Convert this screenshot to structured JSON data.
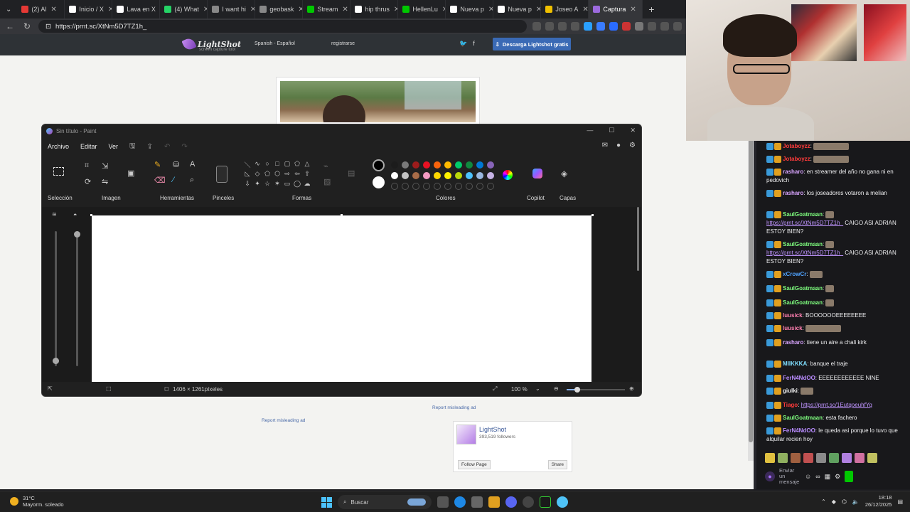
{
  "browser": {
    "tabs": [
      {
        "label": "(2) Al",
        "color": "#e53935"
      },
      {
        "label": "Inicio / X",
        "color": "#ffffff"
      },
      {
        "label": "Lava en X",
        "color": "#ffffff"
      },
      {
        "label": "(4) What",
        "color": "#25d366"
      },
      {
        "label": "I want hi",
        "color": "#888888"
      },
      {
        "label": "geobask",
        "color": "#888888"
      },
      {
        "label": "Stream",
        "color": "#00c800"
      },
      {
        "label": "hip thrus",
        "color": "#ffffff"
      },
      {
        "label": "HellenLu",
        "color": "#00c800"
      },
      {
        "label": "Nueva p",
        "color": "#ffffff"
      },
      {
        "label": "Nueva p",
        "color": "#ffffff"
      },
      {
        "label": "Joseo A",
        "color": "#f0c000"
      },
      {
        "label": "Captura",
        "color": "#9c6ade",
        "active": true
      }
    ],
    "new_tab": "+",
    "url": "https://prnt.sc/XtNm5D7TZ1h_"
  },
  "lightshot": {
    "logo": "LightShot",
    "tagline": "screen capture tool",
    "language": "Spanish - Español",
    "register": "registrarse",
    "download_btn": "Descarga Lightshot gratis",
    "report_ad_1": "Report misleading ad",
    "report_ad_2": "Report misleading ad",
    "fb": {
      "name": "LightShot",
      "followers": "393,519 followers",
      "follow": "Follow Page",
      "share": "Share"
    }
  },
  "paint": {
    "title": "Sin título - Paint",
    "menu": [
      "Archivo",
      "Editar",
      "Ver"
    ],
    "groups": {
      "seleccion": "Selección",
      "imagen": "Imagen",
      "herramientas": "Herramientas",
      "pinceles": "Pinceles",
      "formas": "Formas",
      "colores": "Colores",
      "copilot": "Copilot",
      "capas": "Capas"
    },
    "color_primary": "#000000",
    "color_secondary": "#ffffff",
    "palette": [
      "#1c1c1c",
      "#7a7a7a",
      "#9c1c1c",
      "#e81123",
      "#f7630c",
      "#ffb900",
      "#00cc6a",
      "#10893e",
      "#0078d4",
      "#8764b8",
      "#ffffff",
      "#c3c3c3",
      "#a86c48",
      "#f49ac2",
      "#ffd700",
      "#fff100",
      "#bad80a",
      "#4cc2ff",
      "#9ab8e0",
      "#c7b4e6"
    ],
    "canvas_size": "1406 × 1261píxeles",
    "zoom": "100 %"
  },
  "chat": {
    "messages": [
      {
        "user": "Jotaboyzz",
        "color": "#ff3b3b",
        "text": ":"
      },
      {
        "user": "Jotaboyzz",
        "color": "#ff3b3b",
        "text": ":"
      },
      {
        "user": "rasharo",
        "color": "#d8a4ff",
        "text": ": en streamer del año no gana ni en pedovich"
      },
      {
        "user": "rasharo",
        "color": "#d8a4ff",
        "text": ": los joseadores votaron a melian"
      },
      {
        "user": "SaulGoatmaan",
        "color": "#7fff7f",
        "text": ":"
      },
      {
        "link": "https://prnt.sc/XtNm5D7TZ1h_",
        "text": " CAIGO ASI ADRIAN ESTOY BIEN?"
      },
      {
        "user": "SaulGoatmaan",
        "color": "#7fff7f",
        "text": ":"
      },
      {
        "link": "https://prnt.sc/XtNm5D7TZ1h_",
        "text": " CAIGO ASI ADRIAN ESTOY BIEN?"
      },
      {
        "user": "xCrowCr",
        "color": "#4fa3ff",
        "text": ":"
      },
      {
        "user": "SaulGoatmaan",
        "color": "#7fff7f",
        "text": ":"
      },
      {
        "user": "SaulGoatmaan",
        "color": "#7fff7f",
        "text": ":"
      },
      {
        "user": "luusick",
        "color": "#ff7fb0",
        "text": ": BOOOOOOEEEEEEEE"
      },
      {
        "user": "luusick",
        "color": "#ff7fb0",
        "text": ":"
      },
      {
        "user": "rasharo",
        "color": "#d8a4ff",
        "text": ": tiene un aire a chali kirk"
      },
      {
        "user": "MIIKKKA",
        "color": "#7fdfff",
        "text": ": banque el traje"
      },
      {
        "user": "FerN4NdOO",
        "color": "#b98cff",
        "text": ": EEEEEEEEEEEE NINE"
      },
      {
        "user": "giulki",
        "color": "#f0f0f0",
        "text": ":"
      },
      {
        "user": "Tiago",
        "color": "#ff3b3b",
        "text": ": ",
        "link": "https://prnt.sc/1EutqoeuhfYq"
      },
      {
        "user": "SaulGoatmaan",
        "color": "#7fff7f",
        "text": ": esta fachero"
      },
      {
        "user": "FerN4NdOO",
        "color": "#b98cff",
        "text": ": le queda asi porque lo tuvo que alquilar recien hoy"
      }
    ],
    "input_placeholder": "Enviar un mensaje"
  },
  "taskbar": {
    "temp": "31°C",
    "weather": "Mayorm. soleado",
    "search": "Buscar",
    "time": "18:18",
    "date": "26/12/2025"
  }
}
